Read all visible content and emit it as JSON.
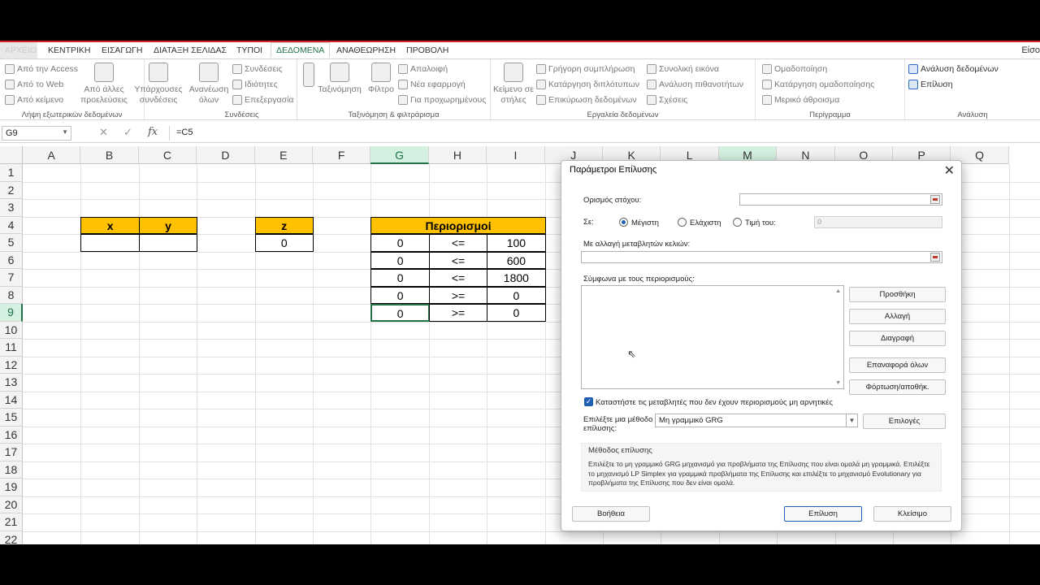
{
  "ribbon": {
    "tabs": [
      "ΑΡΧΕΙΟ",
      "ΚΕΝΤΡΙΚΗ",
      "ΕΙΣΑΓΩΓΗ",
      "ΔΙΑΤΑΞΗ ΣΕΛΙΔΑΣ",
      "ΤΥΠΟΙ",
      "ΔΕΔΟΜΕΝΑ",
      "ΑΝΑΘΕΩΡΗΣΗ",
      "ΠΡΟΒΟΛΗ"
    ],
    "active_tab": "ΔΕΔΟΜΕΝΑ",
    "signin": "Είσο",
    "groups": {
      "external": {
        "label": "Λήψη εξωτερικών δεδομένων",
        "access": "Από την Access",
        "web": "Από το Web",
        "text": "Από κείμενο",
        "other": "Από άλλες προελεύσεις"
      },
      "existing": {
        "label": "Υπάρχουσες συνδέσεις"
      },
      "connections": {
        "label": "Συνδέσεις",
        "refresh": "Ανανέωση όλων",
        "conn": "Συνδέσεις",
        "props": "Ιδιότητες",
        "edit": "Επεξεργασία"
      },
      "sort": {
        "label": "Ταξινόμηση & φιλτράρισμα",
        "sort": "Ταξινόμηση",
        "filter": "Φίλτρο",
        "clear": "Απαλοιφή",
        "reapply": "Νέα εφαρμογή",
        "advanced": "Για προχωρημένους"
      },
      "tools": {
        "label": "Εργαλεία δεδομένων",
        "text_cols": "Κείμενο σε στήλες",
        "flash": "Γρήγορη συμπλήρωση",
        "dupes": "Κατάργηση διπλότυπων",
        "validate": "Επικύρωση δεδομένων",
        "consolidate": "Συνολική εικόνα",
        "whatif": "Ανάλυση πιθανοτήτων",
        "relations": "Σχέσεις"
      },
      "outline": {
        "label": "Περίγραμμα",
        "group": "Ομαδοποίηση",
        "ungroup": "Κατάργηση ομαδοποίησης",
        "subtotal": "Μερικό άθροισμα"
      },
      "analysis": {
        "label": "Ανάλυση",
        "data_analysis": "Ανάλυση δεδομένων",
        "solver": "Επίλυση"
      }
    }
  },
  "formula_bar": {
    "name_box": "G9",
    "formula": "=C5"
  },
  "columns": [
    "A",
    "B",
    "C",
    "D",
    "E",
    "F",
    "G",
    "H",
    "I",
    "J",
    "K",
    "L",
    "M",
    "N",
    "O",
    "P",
    "Q"
  ],
  "rows": [
    "1",
    "2",
    "3",
    "4",
    "5",
    "6",
    "7",
    "8",
    "9",
    "10",
    "11",
    "12",
    "13",
    "14",
    "15",
    "16",
    "17",
    "18",
    "19",
    "20",
    "21",
    "22"
  ],
  "sheet": {
    "x_header": "x",
    "y_header": "y",
    "z_header": "z",
    "z_value": "0",
    "constraints_header": "Περιορισμοί",
    "constraints": [
      {
        "lhs": "0",
        "op": "<=",
        "rhs": "100"
      },
      {
        "lhs": "0",
        "op": "<=",
        "rhs": "600"
      },
      {
        "lhs": "0",
        "op": "<=",
        "rhs": "1800"
      },
      {
        "lhs": "0",
        "op": ">=",
        "rhs": "0"
      },
      {
        "lhs": "0",
        "op": ">=",
        "rhs": "0"
      }
    ]
  },
  "dialog": {
    "title": "Παράμετροι Επίλυσης",
    "objective_label": "Ορισμός στόχου:",
    "to_label": "Σε:",
    "max_label": "Μέγιστη",
    "min_label": "Ελάχιστη",
    "value_label": "Τιμή του:",
    "value_input": "0",
    "changing_label": "Με αλλαγή μεταβλητών κελιών:",
    "constraints_label": "Σύμφωνα με τους περιορισμούς:",
    "add": "Προσθήκη",
    "change": "Αλλαγή",
    "delete": "Διαγραφή",
    "reset": "Επαναφορά όλων",
    "load_save": "Φόρτωση/αποθήκ.",
    "nonneg": "Καταστήστε τις μεταβλητές που δεν έχουν περιορισμούς μη αρνητικές",
    "method_label_1": "Επιλέξτε μια μέθοδο",
    "method_label_2": "επίλυσης:",
    "method_value": "Μη γραμμικό GRG",
    "options": "Επιλογές",
    "method_title": "Μέθοδος επίλυσης",
    "method_text": "Επιλέξτε το μη γραμμικό GRG μηχανισμό για προβλήματα της Επίλυσης που είναι ομαλά μη γραμμικά. Επιλέξτε το μηχανισμό LP Simplex για γραμμικά προβλήματα της Επίλυσης και επιλέξτε το μηχανισμό Evolutionary για προβλήματα της Επίλυσης που δεν είναι ομαλά.",
    "help": "Βοήθεια",
    "solve": "Επίλυση",
    "close": "Κλείσιμο"
  }
}
